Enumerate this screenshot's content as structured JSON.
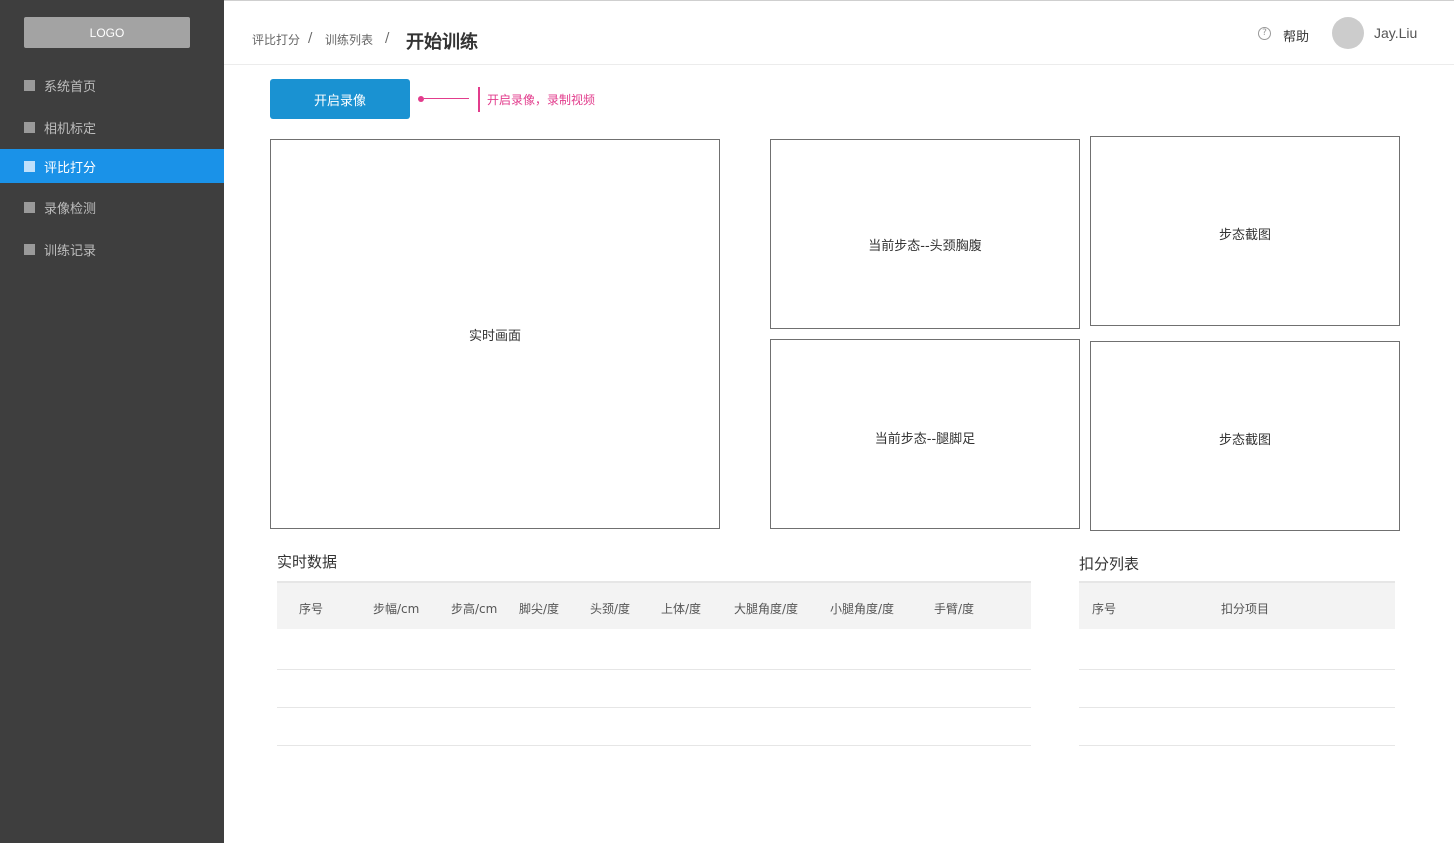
{
  "sidebar": {
    "logo": "LOGO",
    "items": [
      {
        "label": "系统首页"
      },
      {
        "label": "相机标定"
      },
      {
        "label": "评比打分"
      },
      {
        "label": "录像检测"
      },
      {
        "label": "训练记录"
      }
    ]
  },
  "header": {
    "breadcrumb": [
      "评比打分",
      "训练列表"
    ],
    "separator": "/",
    "title": "开始训练",
    "help_icon": "?",
    "help_label": "帮助",
    "username": "Jay.Liu"
  },
  "toolbar": {
    "record_label": "开启录像",
    "annotation": "开启录像，录制视频"
  },
  "panels": {
    "live": "实时画面",
    "step_head": "当前步态--头颈胸腹",
    "step_leg": "当前步态--腿脚足",
    "snapshot_top": "步态截图",
    "snapshot_bottom": "步态截图"
  },
  "realtime": {
    "title": "实时数据",
    "columns": [
      "序号",
      "步幅/cm",
      "步高/cm",
      "脚尖/度",
      "头颈/度",
      "上体/度",
      "大腿角度/度",
      "小腿角度/度",
      "手臂/度"
    ],
    "rows": []
  },
  "deductions": {
    "title": "扣分列表",
    "columns": [
      "序号",
      "扣分项目"
    ],
    "rows": []
  },
  "colors": {
    "sidebar_bg": "#3e3e3e",
    "active_nav": "#1a92e8",
    "primary_button": "#1a92d2",
    "annotation": "#e23c8c"
  }
}
